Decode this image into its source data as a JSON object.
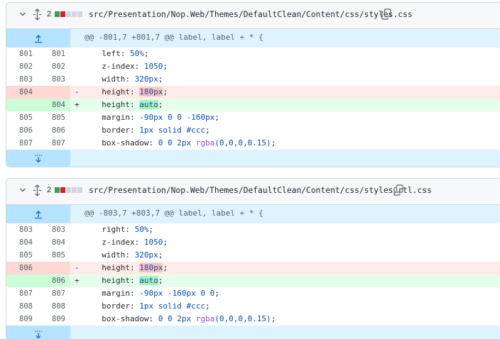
{
  "files": [
    {
      "change_count": "2",
      "path": "src/Presentation/Nop.Web/Themes/DefaultClean/Content/css/styles.css",
      "hunk_header": "@@ -801,7 +801,7 @@ label, label + * {",
      "lines": [
        {
          "type": "ctx",
          "old": "801",
          "new": "801",
          "marker": "",
          "code": [
            {
              "t": "  left: "
            },
            {
              "t": "50%",
              "c": "blue"
            },
            {
              "t": ";"
            }
          ]
        },
        {
          "type": "ctx",
          "old": "802",
          "new": "802",
          "marker": "",
          "code": [
            {
              "t": "  z-index: "
            },
            {
              "t": "1050",
              "c": "blue"
            },
            {
              "t": ";"
            }
          ]
        },
        {
          "type": "ctx",
          "old": "803",
          "new": "803",
          "marker": "",
          "code": [
            {
              "t": "  width: "
            },
            {
              "t": "320px",
              "c": "blue"
            },
            {
              "t": ";"
            }
          ]
        },
        {
          "type": "del",
          "old": "804",
          "new": "",
          "marker": "-",
          "code": [
            {
              "t": "  height: "
            },
            {
              "t": "180px",
              "c": "blue",
              "hl": true
            },
            {
              "t": ";"
            }
          ]
        },
        {
          "type": "add",
          "old": "",
          "new": "804",
          "marker": "+",
          "code": [
            {
              "t": "  height: "
            },
            {
              "t": "auto",
              "c": "blue",
              "hl": true
            },
            {
              "t": ";"
            }
          ]
        },
        {
          "type": "ctx",
          "old": "805",
          "new": "805",
          "marker": "",
          "code": [
            {
              "t": "  margin: "
            },
            {
              "t": "-90px 0 0 -160px",
              "c": "blue"
            },
            {
              "t": ";"
            }
          ]
        },
        {
          "type": "ctx",
          "old": "806",
          "new": "806",
          "marker": "",
          "code": [
            {
              "t": "  border: "
            },
            {
              "t": "1px solid #ccc",
              "c": "blue"
            },
            {
              "t": ";"
            }
          ]
        },
        {
          "type": "ctx",
          "old": "807",
          "new": "807",
          "marker": "",
          "code": [
            {
              "t": "  box-shadow: "
            },
            {
              "t": "0 0 2px ",
              "c": "blue"
            },
            {
              "t": "rgba",
              "c": "purple"
            },
            {
              "t": "(0,0,0,0.15)",
              "c": "blue"
            },
            {
              "t": ";"
            }
          ]
        }
      ]
    },
    {
      "change_count": "2",
      "path": "src/Presentation/Nop.Web/Themes/DefaultClean/Content/css/styles.rtl.css",
      "hunk_header": "@@ -803,7 +803,7 @@ label, label + * {",
      "lines": [
        {
          "type": "ctx",
          "old": "803",
          "new": "803",
          "marker": "",
          "code": [
            {
              "t": "  right: "
            },
            {
              "t": "50%",
              "c": "blue"
            },
            {
              "t": ";"
            }
          ]
        },
        {
          "type": "ctx",
          "old": "804",
          "new": "804",
          "marker": "",
          "code": [
            {
              "t": "  z-index: "
            },
            {
              "t": "1050",
              "c": "blue"
            },
            {
              "t": ";"
            }
          ]
        },
        {
          "type": "ctx",
          "old": "805",
          "new": "805",
          "marker": "",
          "code": [
            {
              "t": "  width: "
            },
            {
              "t": "320px",
              "c": "blue"
            },
            {
              "t": ";"
            }
          ]
        },
        {
          "type": "del",
          "old": "806",
          "new": "",
          "marker": "-",
          "code": [
            {
              "t": "  height: "
            },
            {
              "t": "180px",
              "c": "blue",
              "hl": true
            },
            {
              "t": ";"
            }
          ]
        },
        {
          "type": "add",
          "old": "",
          "new": "806",
          "marker": "+",
          "code": [
            {
              "t": "  height: "
            },
            {
              "t": "auto",
              "c": "blue",
              "hl": true
            },
            {
              "t": ";"
            }
          ]
        },
        {
          "type": "ctx",
          "old": "807",
          "new": "807",
          "marker": "",
          "code": [
            {
              "t": "  margin: "
            },
            {
              "t": "-90px -160px 0 0",
              "c": "blue"
            },
            {
              "t": ";"
            }
          ]
        },
        {
          "type": "ctx",
          "old": "808",
          "new": "808",
          "marker": "",
          "code": [
            {
              "t": "  border: "
            },
            {
              "t": "1px solid #ccc",
              "c": "blue"
            },
            {
              "t": ";"
            }
          ]
        },
        {
          "type": "ctx",
          "old": "809",
          "new": "809",
          "marker": "",
          "code": [
            {
              "t": "  box-shadow: "
            },
            {
              "t": "0 0 2px ",
              "c": "blue"
            },
            {
              "t": "rgba",
              "c": "purple"
            },
            {
              "t": "(0,0,0,0.15)",
              "c": "blue"
            },
            {
              "t": ";"
            }
          ]
        }
      ]
    }
  ],
  "icons": {
    "collapse": "chevron-down-icon",
    "expand_file": "unfold-icon",
    "copy": "copy-path-icon",
    "expand_up": "expand-up-icon",
    "expand_down": "expand-down-icon"
  },
  "colors": {
    "addition": "#e6ffec",
    "deletion": "#ffebe9",
    "hunk": "#ddf4ff",
    "diffstat_add": "#2da44e",
    "diffstat_del": "#cf222e"
  }
}
